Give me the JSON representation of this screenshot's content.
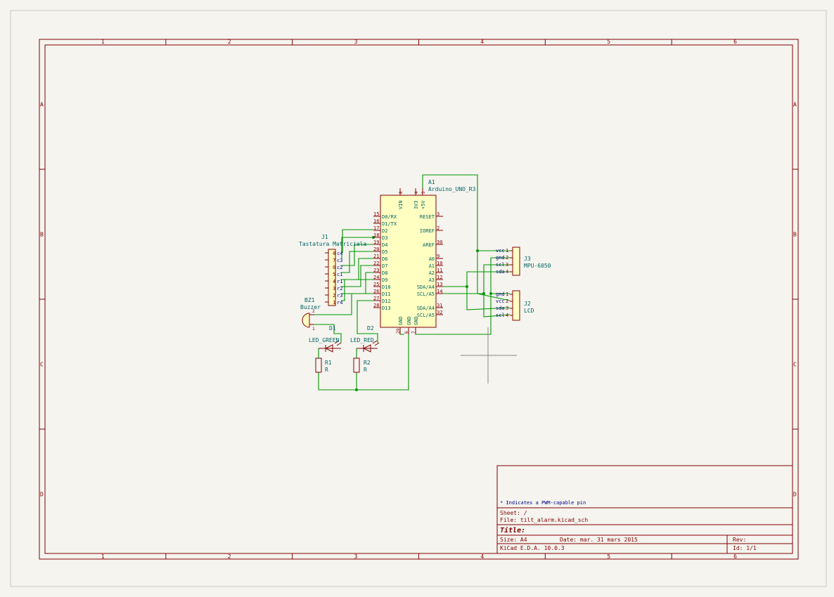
{
  "frame": {
    "cols": [
      "1",
      "2",
      "3",
      "4",
      "5",
      "6"
    ],
    "rows": [
      "A",
      "B",
      "C",
      "D"
    ]
  },
  "arduino": {
    "ref": "A1",
    "value": "Arduino_UNO_R3",
    "top_pins": [
      {
        "num": "8",
        "name": "VIN"
      },
      {
        "num": "4",
        "name": "3V3"
      },
      {
        "num": "5",
        "name": "+5V"
      }
    ],
    "left_pins": [
      {
        "num": "15",
        "name": "D0/RX"
      },
      {
        "num": "16",
        "name": "D1/TX"
      },
      {
        "num": "17",
        "name": "D2"
      },
      {
        "num": "18",
        "name": "D3"
      },
      {
        "num": "19",
        "name": "D4"
      },
      {
        "num": "20",
        "name": "D5"
      },
      {
        "num": "21",
        "name": "D6"
      },
      {
        "num": "22",
        "name": "D7"
      },
      {
        "num": "23",
        "name": "D8"
      },
      {
        "num": "24",
        "name": "D9"
      },
      {
        "num": "25",
        "name": "D10"
      },
      {
        "num": "26",
        "name": "D11"
      },
      {
        "num": "27",
        "name": "D12"
      },
      {
        "num": "28",
        "name": "D13"
      }
    ],
    "right_pins": [
      {
        "num": "3",
        "name": "RESET"
      },
      {
        "num": "2",
        "name": "IOREF"
      },
      {
        "num": "30",
        "name": "AREF"
      },
      {
        "num": "9",
        "name": "A0"
      },
      {
        "num": "10",
        "name": "A1"
      },
      {
        "num": "11",
        "name": "A2"
      },
      {
        "num": "12",
        "name": "A3"
      },
      {
        "num": "13",
        "name": "SDA/A4"
      },
      {
        "num": "14",
        "name": "SCL/A5"
      },
      {
        "num": "31",
        "name": "SDA/A4"
      },
      {
        "num": "32",
        "name": "SCL/A5"
      }
    ],
    "bottom_pins": [
      {
        "num": "29",
        "name": "GND"
      },
      {
        "num": "6",
        "name": "GND"
      },
      {
        "num": "7",
        "name": "GND"
      }
    ]
  },
  "j1": {
    "ref": "J1",
    "value": "Tastatura Matriciala",
    "pins": [
      {
        "num": "8",
        "name": "c4"
      },
      {
        "num": "7",
        "name": "c3"
      },
      {
        "num": "6",
        "name": "c2"
      },
      {
        "num": "5",
        "name": "c1"
      },
      {
        "num": "4",
        "name": "r1"
      },
      {
        "num": "3",
        "name": "r2"
      },
      {
        "num": "2",
        "name": "r3"
      },
      {
        "num": "1",
        "name": "r4"
      }
    ]
  },
  "j3": {
    "ref": "J3",
    "value": "MPU-6050",
    "pins": [
      {
        "num": "1",
        "name": "vcc"
      },
      {
        "num": "2",
        "name": "gnd"
      },
      {
        "num": "3",
        "name": "scl"
      },
      {
        "num": "4",
        "name": "sda"
      }
    ]
  },
  "j2": {
    "ref": "J2",
    "value": "LCD",
    "pins": [
      {
        "num": "1",
        "name": "gnd"
      },
      {
        "num": "2",
        "name": "vcc"
      },
      {
        "num": "3",
        "name": "sda"
      },
      {
        "num": "4",
        "name": "scl"
      }
    ]
  },
  "bz1": {
    "ref": "BZ1",
    "value": "Buzzer",
    "pin1": "1",
    "pin2": "2"
  },
  "d1": {
    "ref": "D1",
    "value": "LED_GREEN"
  },
  "d2": {
    "ref": "D2",
    "value": "LED_RED"
  },
  "r1": {
    "ref": "R1",
    "value": "R"
  },
  "r2": {
    "ref": "R2",
    "value": "R"
  },
  "title_block": {
    "note": "* Indicates a PWM-capable pin",
    "sheet": "Sheet: /",
    "file": "File: tilt_alarm.kicad_sch",
    "title": "Title:",
    "size": "Size: A4",
    "date": "Date: mar. 31 mars 2015",
    "rev": "Rev:",
    "tool": "KiCad E.D.A. 10.0.3",
    "id": "Id: 1/1"
  },
  "colors": {
    "border": "#840000",
    "wire": "#009600",
    "pin_text": "#840000",
    "symbol_text": "#006464",
    "connector_label": "#000084",
    "title_text": "#840000"
  }
}
